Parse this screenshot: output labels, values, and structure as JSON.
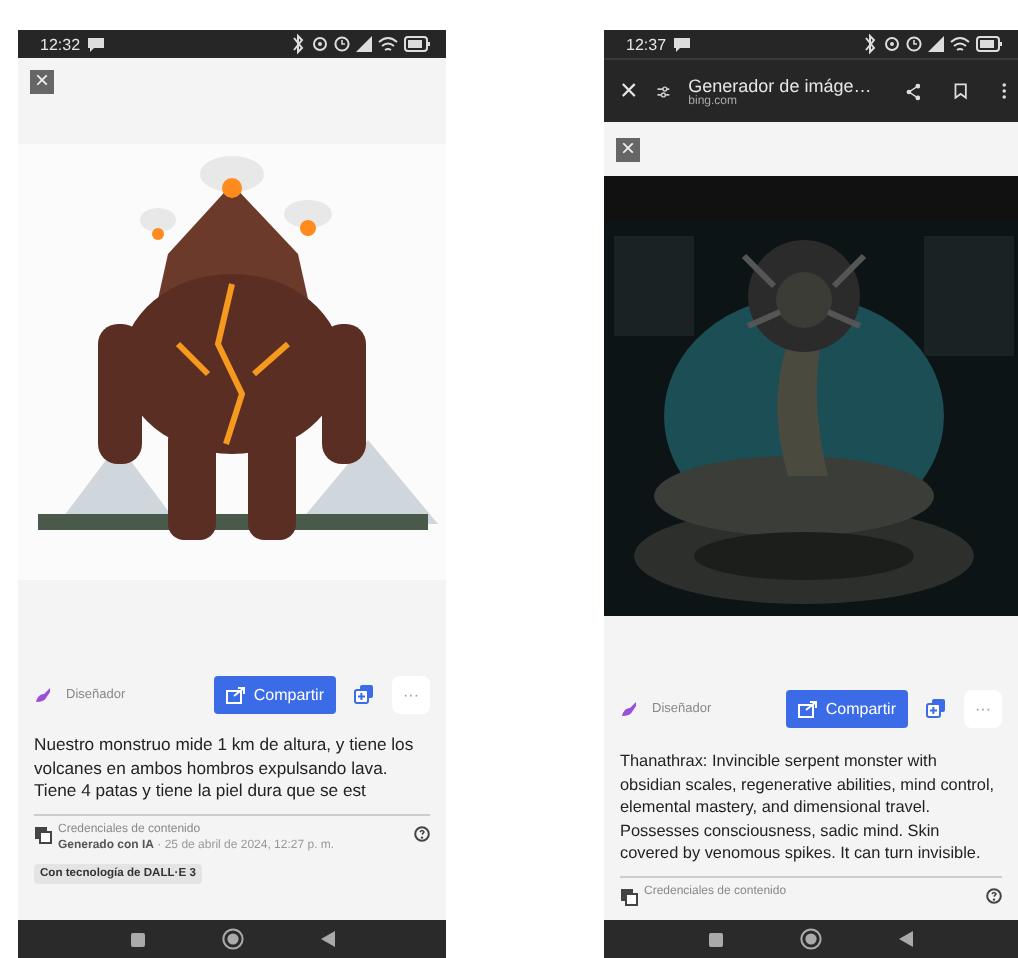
{
  "phones": [
    {
      "status_bar": {
        "time": "12:32"
      },
      "close_label": "×",
      "designer_label": "Diseñador",
      "share_button": "Compartir",
      "more_button": "···",
      "prompt": "Nuestro monstruo mide 1 km de altura, y tiene los volcanes en ambos hombros expulsando lava. Tiene 4 patas y tiene la piel dura que se est",
      "credentials_title": "Credenciales de contenido",
      "credentials_detail": "**Generado con IA** · 25 de abril de 2024, 12:27 p. m.",
      "badge": "Con tecnología de DALL·E 3"
    },
    {
      "status_bar": {
        "time": "12:37"
      },
      "browser_bar": {
        "close_label": "×",
        "title": "Generador de imáge…",
        "url": "bing.com"
      },
      "close_label": "×",
      "designer_label": "Diseñador",
      "share_button": "Compartir",
      "more_button": "···",
      "prompt": "Thanathrax: Invincible serpent monster with obsidian scales, regenerative abilities, mind control, elemental mastery, and dimensional travel. Possesses consciousness, sadic mind. Skin covered by venomous spikes. It can turn invisible.",
      "credentials_title": "Credenciales de contenido"
    }
  ]
}
